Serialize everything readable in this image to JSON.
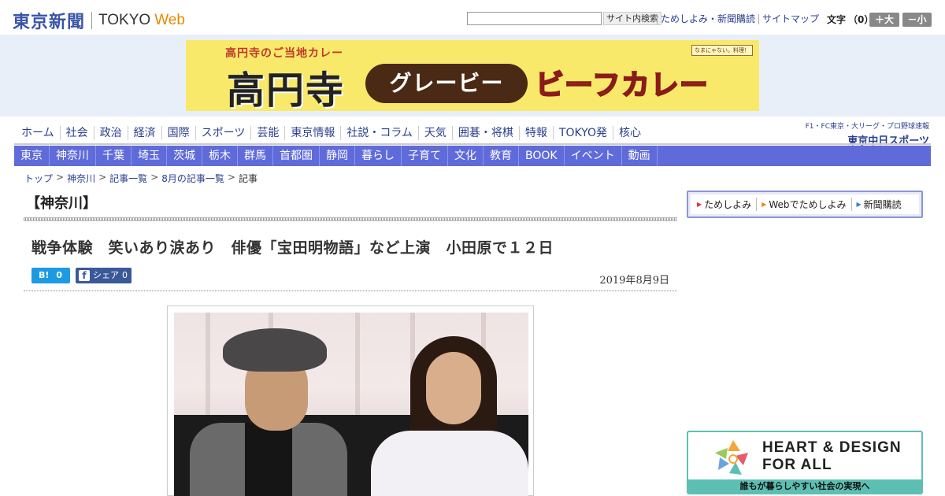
{
  "header": {
    "logo_jp": "東京新聞",
    "logo_en": "TOKYO",
    "logo_web": "Web",
    "search": {
      "placeholder": "",
      "button": "サイト内検索"
    },
    "links": [
      "ためしよみ・新聞購読",
      "サイトマップ"
    ],
    "font_size_label": "文字",
    "font_size_count": "（0）",
    "font_bigger": "＋大",
    "font_smaller": "－小"
  },
  "banner": {
    "top": "高円寺のご当地カレー",
    "kouenji": "高円寺",
    "gravy": "グレービー",
    "beef": "ビーフカレー",
    "badge": "なまにゃない。料理！"
  },
  "main_nav": [
    "ホーム",
    "社会",
    "政治",
    "経済",
    "国際",
    "スポーツ",
    "芸能",
    "東京情報",
    "社説・コラム",
    "天気",
    "囲碁・将棋",
    "特報",
    "TOKYO発",
    "核心"
  ],
  "chunichi": {
    "top": "F1・FC東京・大リーグ・プロ野球速報",
    "logo": "東京中日スポーツ"
  },
  "region_nav": [
    "東京",
    "神奈川",
    "千葉",
    "埼玉",
    "茨城",
    "栃木",
    "群馬",
    "首都圏",
    "静岡",
    "暮らし",
    "子育て",
    "文化",
    "教育",
    "BOOK",
    "イベント",
    "動画"
  ],
  "breadcrumb": [
    "トップ",
    "神奈川",
    "記事一覧",
    "8月の記事一覧",
    "記事"
  ],
  "section": {
    "title": "【神奈川】"
  },
  "article": {
    "title": "戦争体験　笑いあり涙あり　俳優「宝田明物語」など上演　小田原で１２日",
    "date": "2019年8月9日",
    "hatena_label": "B!",
    "hatena_count": "0",
    "fb_icon": "f",
    "fb_label": "シェア",
    "fb_count": "0"
  },
  "sidebar": {
    "links": [
      "ためしよみ",
      "Webでためしよみ",
      "新聞購読"
    ],
    "heart_title_line1": "HEART & DESIGN",
    "heart_title_line2": "FOR ALL",
    "heart_sub": "誰もが暮らしやすい社会の実現へ"
  },
  "colors": {
    "brand_blue": "#3a55a8",
    "nav_link": "#2a3f8e",
    "region_nav_bg": "#5f6bd9",
    "banner_bg": "#e9eff8",
    "heart_teal": "#5dbfb3"
  }
}
